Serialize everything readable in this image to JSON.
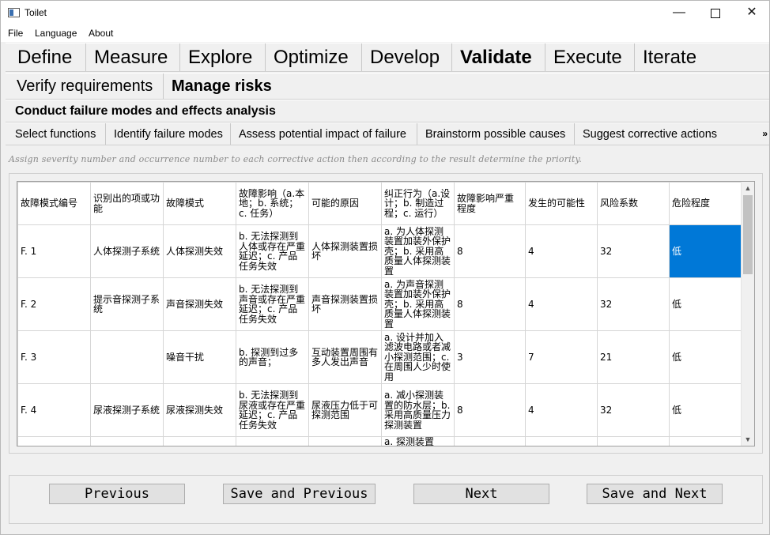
{
  "window": {
    "title": "Toilet",
    "minimize_glyph": "—",
    "close_glyph": "✕"
  },
  "menu": {
    "items": [
      "File",
      "Language",
      "About"
    ]
  },
  "phases": {
    "items": [
      "Define",
      "Measure",
      "Explore",
      "Optimize",
      "Develop",
      "Validate",
      "Execute",
      "Iterate"
    ],
    "active": "Validate"
  },
  "subtabs": {
    "items": [
      "Verify requirements",
      "Manage risks"
    ],
    "active": "Manage risks"
  },
  "section": {
    "title": "Conduct failure modes and effects analysis"
  },
  "steps": {
    "items": [
      "Select functions",
      "Identify failure modes",
      "Assess potential impact of failure",
      "Brainstorm possible causes",
      "Suggest corrective actions"
    ],
    "overflow_glyph": "»"
  },
  "hint": "Assign severity number and occurrence number to each corrective action then according to the result determine the priority.",
  "table": {
    "headers": [
      "故障模式编号",
      "识别出的项或功能",
      "故障模式",
      "故障影响（a.本地；b. 系统；c. 任务）",
      "可能的原因",
      "纠正行为（a.设计；b. 制造过程；c. 运行）",
      "故障影响严重程度",
      "发生的可能性",
      "风险系数",
      "危险程度"
    ],
    "rows": [
      [
        "F. 1",
        "人体探测子系统",
        "人体探测失效",
        "b. 无法探测到人体或存在严重延迟；c. 产品任务失效",
        "人体探测装置损坏",
        "a. 为人体探测装置加装外保护壳；b. 采用高质量人体探测装置",
        "8",
        "4",
        "32",
        "低"
      ],
      [
        "F. 2",
        "提示音探测子系统",
        "声音探测失效",
        "b. 无法探测到声音或存在严重延迟；c. 产品任务失效",
        "声音探测装置损坏",
        "a. 为声音探测装置加装外保护壳；b. 采用高质量人体探测装置",
        "8",
        "4",
        "32",
        "低"
      ],
      [
        "F. 3",
        "",
        "噪音干扰",
        "b. 探测到过多的声音；",
        "互动装置周围有多人发出声音",
        "a. 设计并加入滤波电路或者减小探测范围；c. 在周围人少时使用",
        "3",
        "7",
        "21",
        "低"
      ],
      [
        "F. 4",
        "尿液探测子系统",
        "尿液探测失效",
        "b. 无法探测到尿液或存在严重延迟；c. 产品任务失效",
        "尿液压力低于可探测范围",
        "a. 减小探测装置的防水层；b. 采用高质量压力探测装置",
        "8",
        "4",
        "32",
        "低"
      ],
      [
        "",
        "",
        "",
        "",
        "",
        "a. 探测装置",
        "",
        "",
        "",
        ""
      ]
    ],
    "selected_cell": "row 1, 危险程度",
    "scroll_up_glyph": "▲",
    "scroll_down_glyph": "▼"
  },
  "buttons": {
    "previous": "Previous",
    "save_previous": "Save and Previous",
    "next": "Next",
    "save_next": "Save and Next"
  }
}
